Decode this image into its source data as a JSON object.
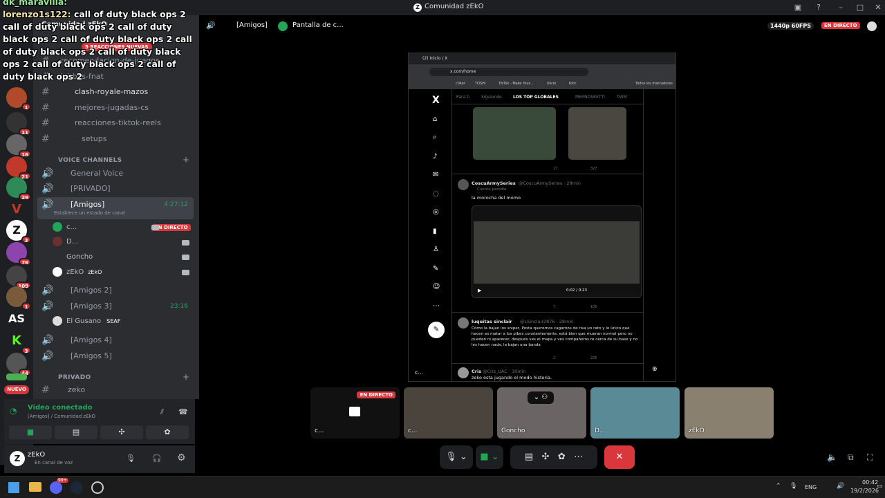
{
  "window": {
    "title": "Comunidad zEkO"
  },
  "overlay_chat": {
    "prev_line": "dk_maravilla:",
    "user": "lorenzo1s122:",
    "message": "call of duty black ops 2 call of duty black ops 2 call of duty black ops 2 call of duty black ops 2 call of duty black ops 2 call of duty black ops 2 call of duty black ops 2 call of duty black ops 2"
  },
  "server_header": {
    "name": "Comunidad zEkO",
    "boost_pill": "5 REACCIONES NUEVAS"
  },
  "text_channels": [
    {
      "name": "recomendacion-de-juegos"
    },
    {
      "name": "lobbys-fnat"
    },
    {
      "name": "clash-royale-mazos"
    },
    {
      "name": "mejores-jugadas-cs"
    },
    {
      "name": "reacciones-tiktok-reels"
    },
    {
      "name": "setups"
    }
  ],
  "voice_category": "VOICE CHANNELS",
  "voice_channels": {
    "general": "General Voice",
    "privado": "[PRIVADO]",
    "amigos": "[Amigos]",
    "amigos_time": "4:27:12",
    "amigos_status": "Establece un estado de canal",
    "amigos2": "[Amigos 2]",
    "amigos3": "[Amigos 3]",
    "amigos3_time": "23:16",
    "amigos4": "[Amigos 4]",
    "amigos5": "[Amigos 5]"
  },
  "voice_users": [
    {
      "name": "c...",
      "live": "EN DIRECTO"
    },
    {
      "name": "D..."
    },
    {
      "name": "Goncho"
    },
    {
      "name": "zEkO",
      "tag": "zEkO"
    }
  ],
  "amigos3_user": {
    "name": "El Gusano",
    "tag": "SEAF"
  },
  "privado_category": "PRIVADO",
  "privado_channel": "zeko",
  "server_badges": [
    "1",
    "11",
    "16",
    "21",
    "29",
    "3",
    "76",
    "109",
    "1",
    "3",
    "44"
  ],
  "new_label": "NUEVO",
  "voice_connected": {
    "status": "Video conectado",
    "location": "[Amigos] / Comunidad zEkO"
  },
  "user_panel": {
    "name": "zEkO",
    "status": "En canal de voz"
  },
  "topbar": {
    "channel": "[Amigos]",
    "stream_title": "Pantalla de c...",
    "quality": "1440p 60FPS",
    "live": "EN DIRECTO"
  },
  "browser": {
    "tab_title": "(2) Inicio / X",
    "url": "x.com/home",
    "bookmarks": [
      "c0ker",
      "TOSHI",
      "TikTok - Make Your...",
      "Inicio",
      "Kick"
    ],
    "all_bookmarks": "Todos los marcadores",
    "feed_tabs": [
      "Para ti",
      "Siguiendo",
      "LOS TOP GLOBALES",
      "MERNOSKETTI",
      "TWM"
    ],
    "tweet1": {
      "stats": [
        "17",
        "327"
      ]
    },
    "tweet2": {
      "author": "CoscuArmySeries",
      "handle": "@CoscuArmySeries · 28min",
      "sub": "Cuenta parodia",
      "text": "la morocha del momo",
      "video_time": "0:02 / 0:23",
      "stats": [
        "7",
        "105"
      ]
    },
    "tweet3": {
      "author": "luquitas sinclair",
      "handle": "@LSinclair2876 · 28min",
      "text": "Cómo la bajan los sniper, Posta queremos cagarnos de risa un rato y lo único que hacen es matar a los pibes constantemente, está bien que mueran normal pero no pueden ni aparecer, después ves el mapa y ves compañeros re cerca de su base y no les hacen nada, la bajan una banda",
      "stats": [
        "2",
        "225"
      ]
    },
    "tweet4": {
      "author": "Cris",
      "handle": "@Cris_UAC · 30min",
      "text": "zeko esta jugando el modo historia."
    }
  },
  "tiles": [
    {
      "label": "c...",
      "live": "EN DIRECTO"
    },
    {
      "label": "c..."
    },
    {
      "label": "Goncho"
    },
    {
      "label": "D..."
    },
    {
      "label": "zEkO"
    }
  ],
  "stage_corner_label": "c...",
  "taskbar": {
    "lang": "ENG",
    "time": "00:42",
    "date": "19/2/2026",
    "discord_badge": "99+"
  },
  "colors": {
    "live_red": "#da373c",
    "green": "#23a559",
    "bg": "#000000",
    "sidebar": "#2b2d31",
    "end_call": "#da373c"
  }
}
